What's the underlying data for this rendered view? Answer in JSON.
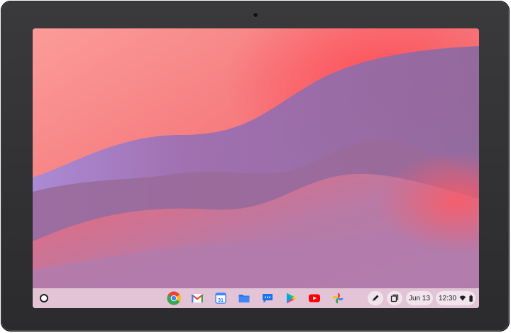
{
  "shelf": {
    "launcher_icon": "launcher-circle-icon",
    "pinned_apps": [
      {
        "name": "chrome",
        "icon": "chrome-icon"
      },
      {
        "name": "gmail",
        "icon": "gmail-icon"
      },
      {
        "name": "calendar",
        "icon": "calendar-icon",
        "text": "31"
      },
      {
        "name": "files",
        "icon": "files-icon"
      },
      {
        "name": "chat",
        "icon": "chat-icon"
      },
      {
        "name": "play-store",
        "icon": "play-store-icon"
      },
      {
        "name": "youtube",
        "icon": "youtube-icon"
      },
      {
        "name": "photos",
        "icon": "photos-icon"
      }
    ]
  },
  "tray": {
    "date": "Jun 13",
    "time": "12:30",
    "stylus_icon": "stylus-icon",
    "overview_icon": "overview-icon",
    "wifi_icon": "wifi-icon",
    "battery_icon": "battery-icon"
  },
  "colors": {
    "bezel": "#2b2b2d",
    "wallpaper_coral": "#f47a7e",
    "wallpaper_purple": "#9a6a9a",
    "shelf": "#f5e1e8"
  }
}
